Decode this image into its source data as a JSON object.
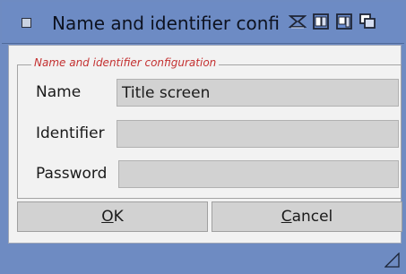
{
  "window": {
    "title": "Name and identifier confi",
    "icons": [
      "close-box-icon",
      "depth-icon",
      "zoom-icon",
      "iconify-icon",
      "snapshot-icon",
      "resize-grip-icon"
    ],
    "accent_color": "#6d8bc4"
  },
  "group": {
    "legend": "Name and identifier configuration",
    "legend_color": "#c43131"
  },
  "fields": [
    {
      "label": "Name",
      "value": "Title screen"
    },
    {
      "label": "Identifier",
      "value": ""
    },
    {
      "label": "Password",
      "value": ""
    }
  ],
  "buttons": {
    "ok_mnemonic": "O",
    "ok_rest": "K",
    "cancel_mnemonic": "C",
    "cancel_rest": "ancel"
  }
}
